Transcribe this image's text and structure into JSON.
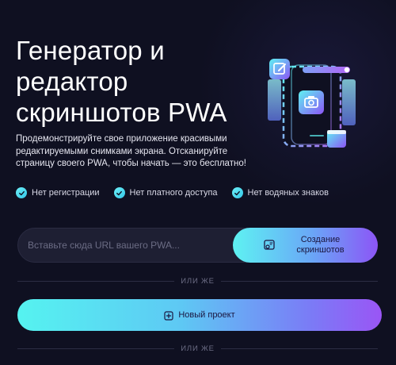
{
  "hero": {
    "title": "Генератор и редактор скриншотов PWA",
    "description": "Продемонстрируйте свое приложение красивыми редактируемыми снимками экрана. Отсканируйте страницу своего PWA, чтобы начать — это бесплатно!"
  },
  "features": [
    {
      "label": "Нет регистрации"
    },
    {
      "label": "Нет платного доступа"
    },
    {
      "label": "Нет водяных знаков"
    }
  ],
  "url_form": {
    "placeholder": "Вставьте сюда URL вашего PWA...",
    "value": "",
    "button_label": "Создание скриншотов"
  },
  "dividers": {
    "or_label": "ИЛИ ЖЕ"
  },
  "new_project": {
    "label": "Новый проект"
  },
  "colors": {
    "background": "#0f1021",
    "accent_cyan": "#5ef2f2",
    "accent_purple": "#8c55f6"
  },
  "icons": [
    "edit-icon",
    "camera-icon",
    "check-icon",
    "screenshot-icon",
    "plus-square-icon"
  ]
}
